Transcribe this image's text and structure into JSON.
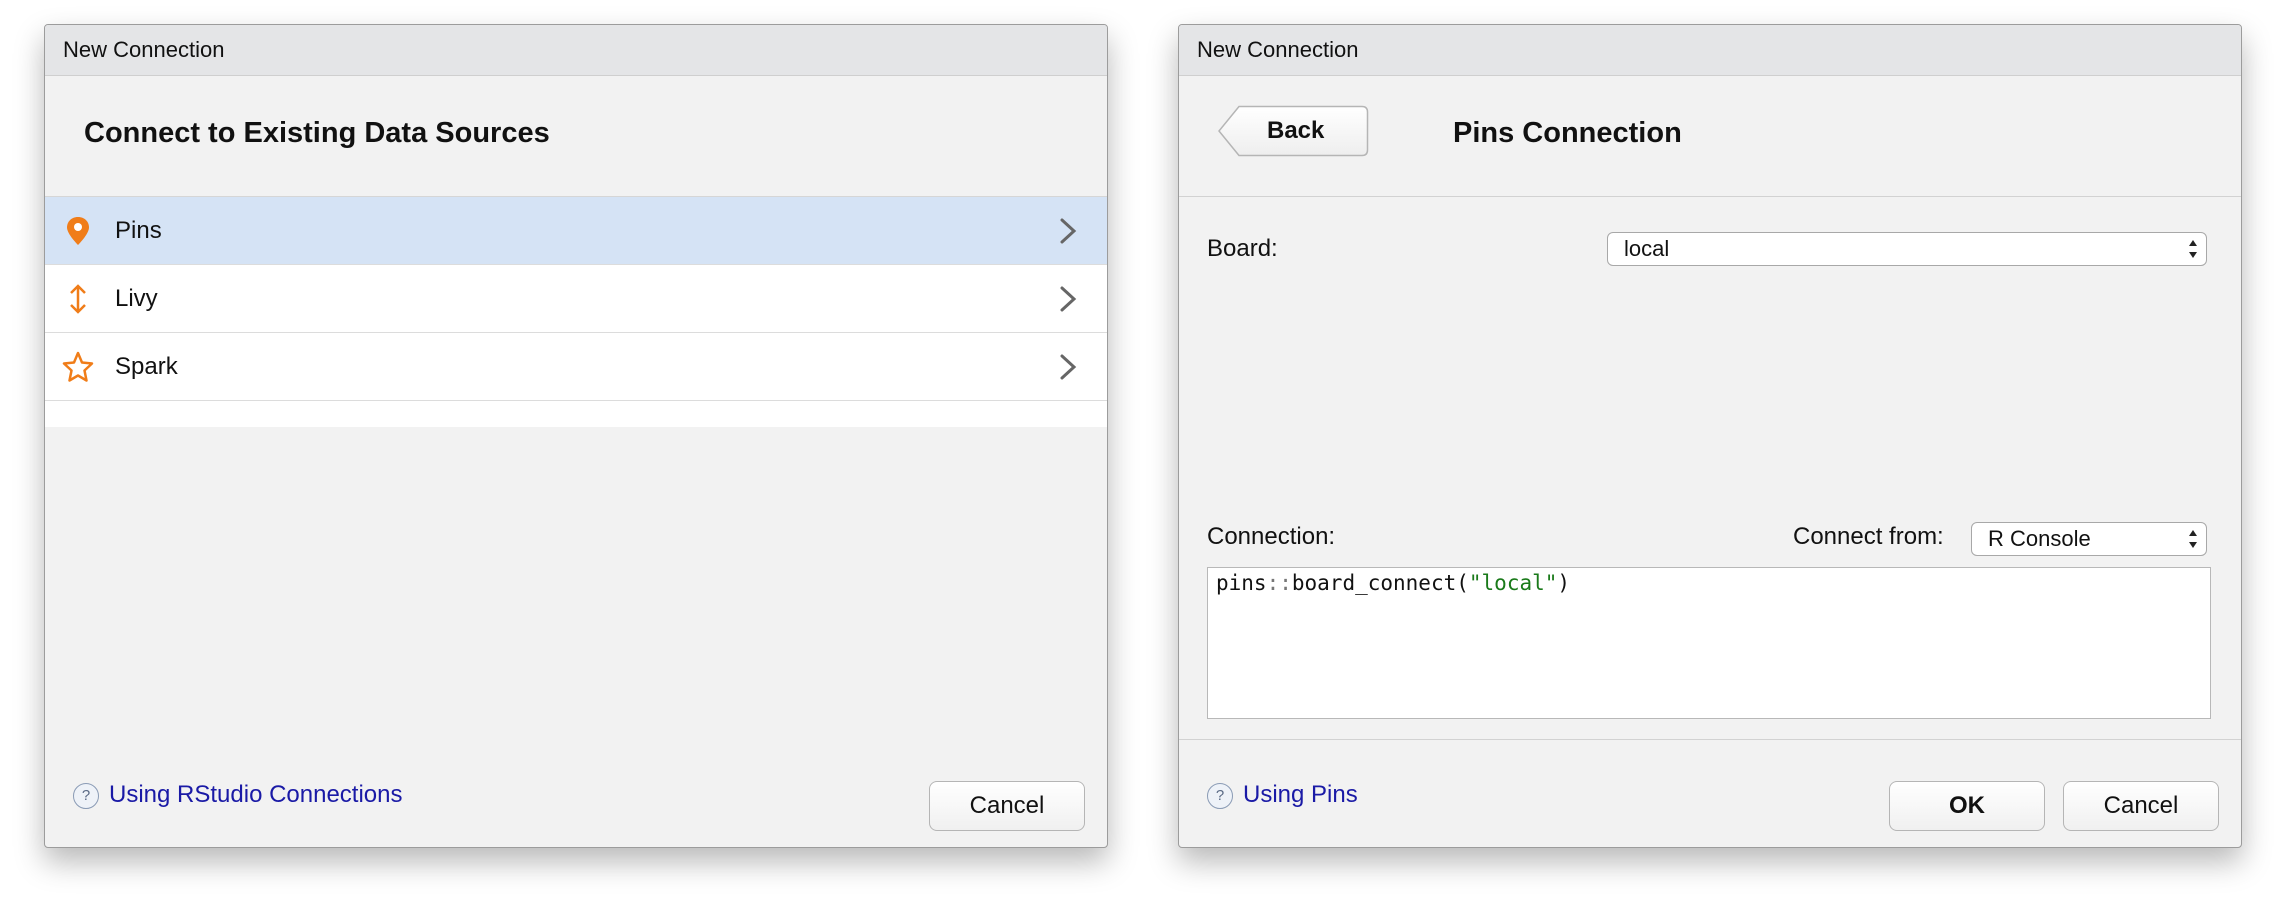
{
  "left_dialog": {
    "title": "New Connection",
    "heading": "Connect to Existing Data Sources",
    "items": [
      {
        "label": "Pins",
        "icon": "pin-icon",
        "selected": true
      },
      {
        "label": "Livy",
        "icon": "updown-arrow-icon",
        "selected": false
      },
      {
        "label": "Spark",
        "icon": "star-icon",
        "selected": false
      }
    ],
    "help_link": "Using RStudio Connections",
    "cancel_label": "Cancel"
  },
  "right_dialog": {
    "title": "New Connection",
    "back_label": "Back",
    "heading": "Pins Connection",
    "board_label": "Board:",
    "board_value": "local",
    "connection_label": "Connection:",
    "connect_from_label": "Connect from:",
    "connect_from_value": "R Console",
    "code": {
      "pkg": "pins",
      "sep": "::",
      "func": "board_connect(",
      "arg": "\"local\"",
      "close": ")"
    },
    "help_link": "Using Pins",
    "ok_label": "OK",
    "cancel_label": "Cancel"
  },
  "colors": {
    "accent_icon": "#f07d19",
    "selected_row": "#d5e3f5",
    "link": "#1a1aa6",
    "code_string": "#1a7a1a"
  }
}
